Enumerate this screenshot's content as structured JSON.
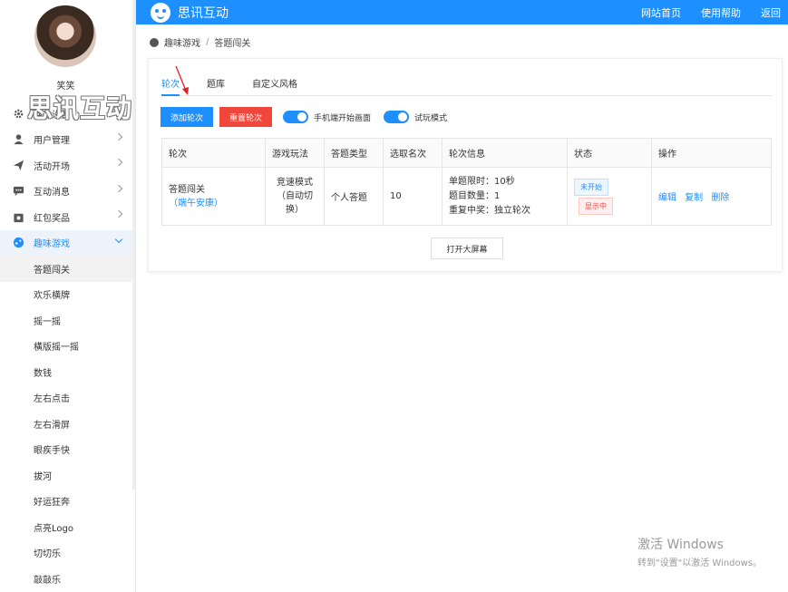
{
  "sidebar": {
    "username": "笑笑",
    "watermark": "思讯互动",
    "items": [
      {
        "label": "活动设置",
        "icon": "gear-icon"
      },
      {
        "label": "用户管理",
        "icon": "user-icon"
      },
      {
        "label": "活动开场",
        "icon": "send-icon"
      },
      {
        "label": "互动消息",
        "icon": "chat-icon"
      },
      {
        "label": "红包奖品",
        "icon": "gift-icon"
      },
      {
        "label": "趣味游戏",
        "icon": "game-icon"
      }
    ],
    "subitems": [
      "答题闯关",
      "欢乐横牌",
      "摇一摇",
      "橫版摇一摇",
      "数钱",
      "左右点击",
      "左右滑屏",
      "眼疾手快",
      "拔河",
      "好运狂奔",
      "点亮Logo",
      "切切乐",
      "敲敲乐"
    ]
  },
  "header": {
    "brand": "思讯互动",
    "links": [
      "网站首页",
      "使用帮助",
      "返回"
    ]
  },
  "breadcrumb": {
    "parent": "趣味游戏",
    "sep": "/",
    "current": "答题闯关"
  },
  "tabs": [
    "轮次",
    "题库",
    "自定义风格"
  ],
  "toolbar": {
    "add": "添加轮次",
    "reset": "重置轮次",
    "switch1": "手机端开始画面",
    "switch2": "试玩模式"
  },
  "table": {
    "headers": [
      "轮次",
      "游戏玩法",
      "答题类型",
      "选取名次",
      "轮次信息",
      "状态",
      "操作"
    ],
    "row": {
      "name": "答题闯关",
      "name_link": "（端午安康）",
      "mode": "竞速模式（自动切换）",
      "type": "个人答题",
      "count": "10",
      "info1": "单题限时：10秒",
      "info2": "题目数量：1",
      "info3": "重复中奖：独立轮次",
      "status1": "未开始",
      "status2": "显示中",
      "op_edit": "编辑",
      "op_copy": "复制",
      "op_delete": "删除"
    }
  },
  "big_screen": "打开大屏幕",
  "activation": {
    "title": "激活 Windows",
    "sub": "转到\"设置\"以激活 Windows。"
  },
  "colors": {
    "accent": "#1e8fff",
    "danger": "#f0463c"
  }
}
